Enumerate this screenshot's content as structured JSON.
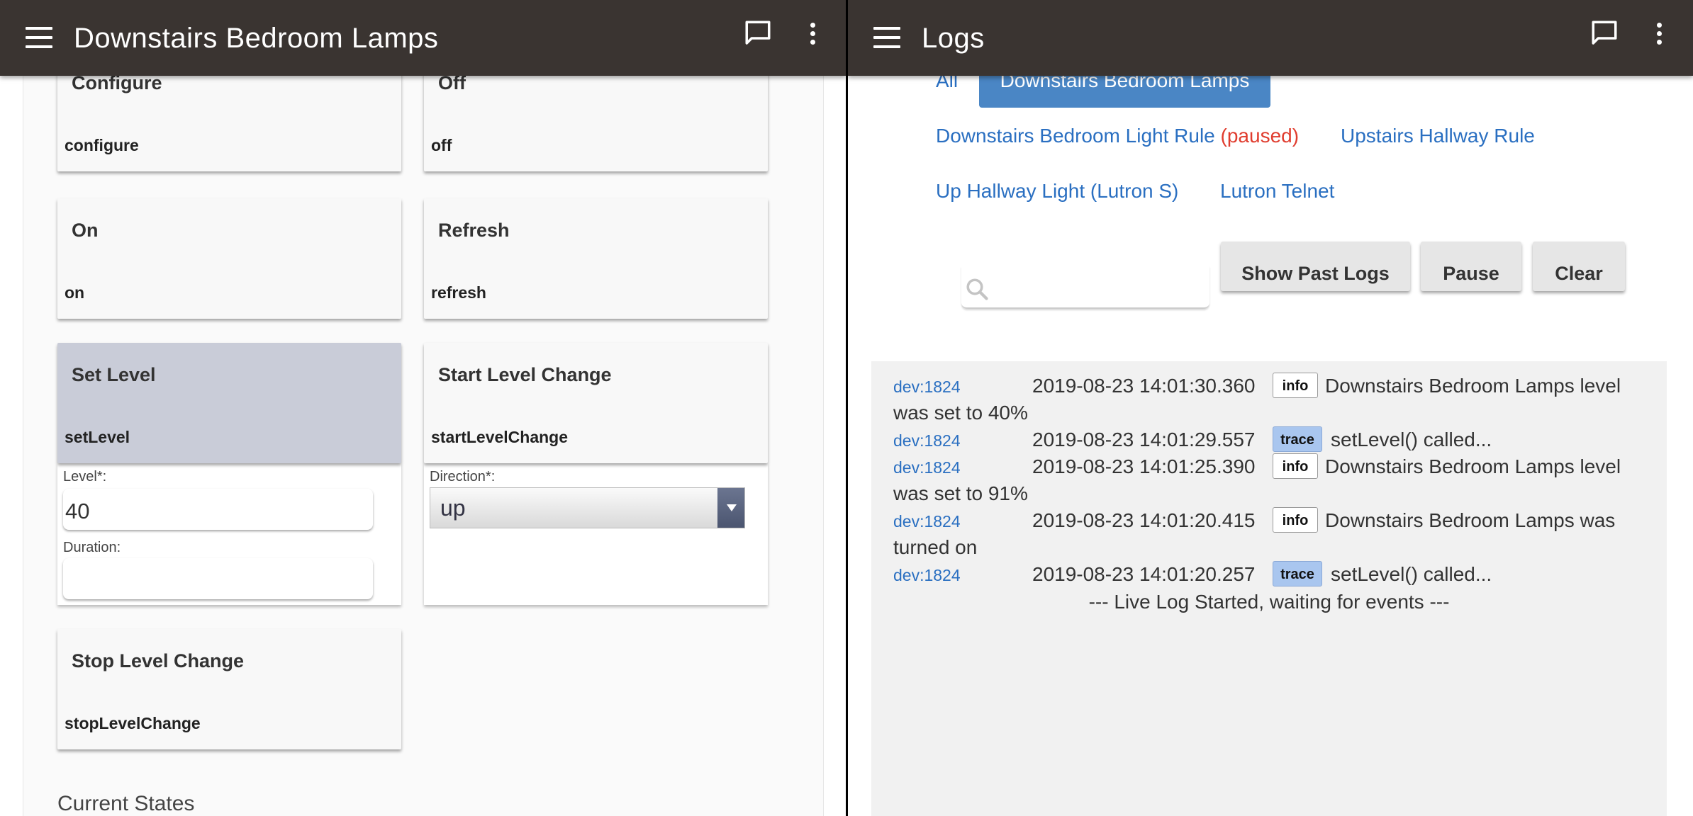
{
  "left": {
    "appbar": {
      "title": "Downstairs Bedroom Lamps"
    },
    "commands": [
      {
        "title": "Configure",
        "method": "configure"
      },
      {
        "title": "Off",
        "method": "off"
      },
      {
        "title": "On",
        "method": "on"
      },
      {
        "title": "Refresh",
        "method": "refresh"
      },
      {
        "title": "Set Level",
        "method": "setLevel"
      },
      {
        "title": "Start Level Change",
        "method": "startLevelChange"
      },
      {
        "title": "Stop Level Change",
        "method": "stopLevelChange"
      }
    ],
    "set_level_params": {
      "level_label": "Level*:",
      "level_value": "40",
      "duration_label": "Duration:",
      "duration_value": ""
    },
    "start_level_change_params": {
      "direction_label": "Direction*:",
      "direction_value": "up"
    },
    "current_states_label": "Current States"
  },
  "right": {
    "appbar": {
      "title": "Logs"
    },
    "filters": {
      "all": "All",
      "active": "Downstairs Bedroom Lamps",
      "rule1": "Downstairs Bedroom Light Rule",
      "rule1_status": "(paused)",
      "rule2": "Upstairs Hallway Rule",
      "device2": "Up Hallway Light (Lutron S)",
      "device3": "Lutron Telnet"
    },
    "search": {
      "placeholder": ""
    },
    "buttons": {
      "show_past": "Show Past Logs",
      "pause": "Pause",
      "clear": "Clear"
    },
    "logs": [
      {
        "dev": "dev:1824",
        "time": "2019-08-23 14:01:30.360",
        "level": "info",
        "msg": "Downstairs Bedroom Lamps level",
        "cont": "was set to 40%"
      },
      {
        "dev": "dev:1824",
        "time": "2019-08-23 14:01:29.557",
        "level": "trace",
        "msg": "setLevel() called...",
        "cont": ""
      },
      {
        "dev": "dev:1824",
        "time": "2019-08-23 14:01:25.390",
        "level": "info",
        "msg": "Downstairs Bedroom Lamps level",
        "cont": "was set to 91%"
      },
      {
        "dev": "dev:1824",
        "time": "2019-08-23 14:01:20.415",
        "level": "info",
        "msg": "Downstairs Bedroom Lamps was",
        "cont": "turned on"
      },
      {
        "dev": "dev:1824",
        "time": "2019-08-23 14:01:20.257",
        "level": "trace",
        "msg": "setLevel() called...",
        "cont": ""
      }
    ],
    "live_started": "--- Live Log Started, waiting for events ---"
  }
}
